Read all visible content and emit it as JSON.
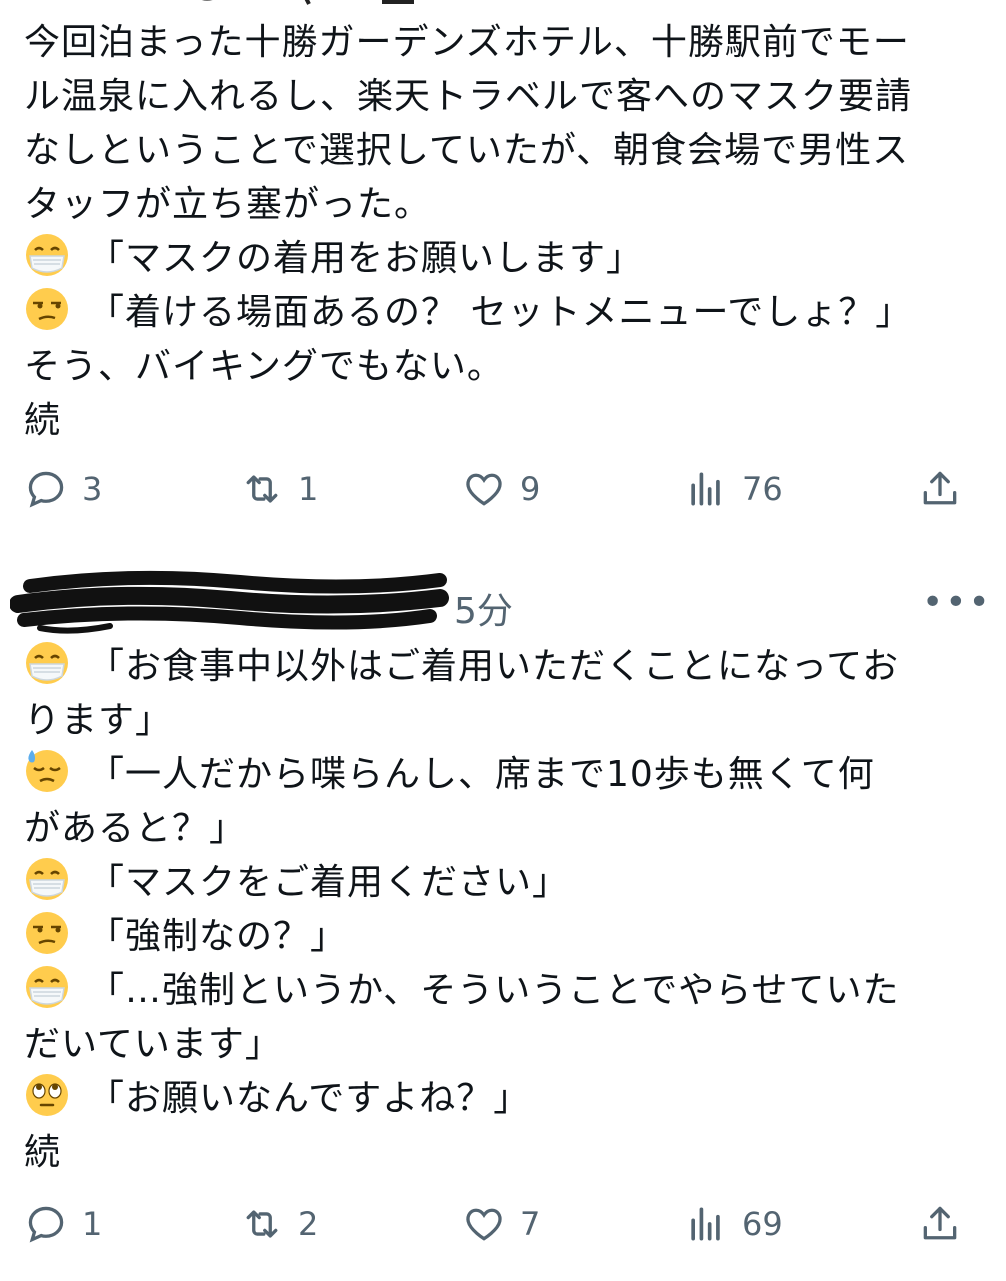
{
  "post1": {
    "lines": [
      "今回泊まった十勝ガーデンズホテル、十勝駅前でモー",
      "ル温泉に入れるし、楽天トラベルで客へのマスク要請",
      "なしということで選択していたが、朝食会場で男性ス",
      "タッフが立ち塞がった。",
      "「マスクの着用をお願いします」",
      "「着ける場面あるの？ セットメニューでしょ？」",
      "そう、バイキングでもない。",
      "続"
    ],
    "actions": {
      "replies": "3",
      "retweets": "1",
      "likes": "9",
      "views": "76"
    }
  },
  "post2": {
    "time": "5分",
    "more": "•••",
    "lines": [
      "「お食事中以外はご着用いただくことになってお",
      "ります」",
      "「一人だから喋らんし、席まで10歩も無くて何",
      "があると？」",
      "「マスクをご着用ください」",
      "「強制なの？」",
      "「…強制というか、そういうことでやらせていた",
      "だいています」",
      "「お願いなんですよね？」",
      "続"
    ],
    "actions": {
      "replies": "1",
      "retweets": "2",
      "likes": "7",
      "views": "69"
    }
  },
  "icons": {
    "mask": "face-with-medical-mask",
    "unamused": "unamused-face",
    "sweat": "downcast-face-with-sweat",
    "rolling_eyes": "face-with-rolling-eyes"
  }
}
